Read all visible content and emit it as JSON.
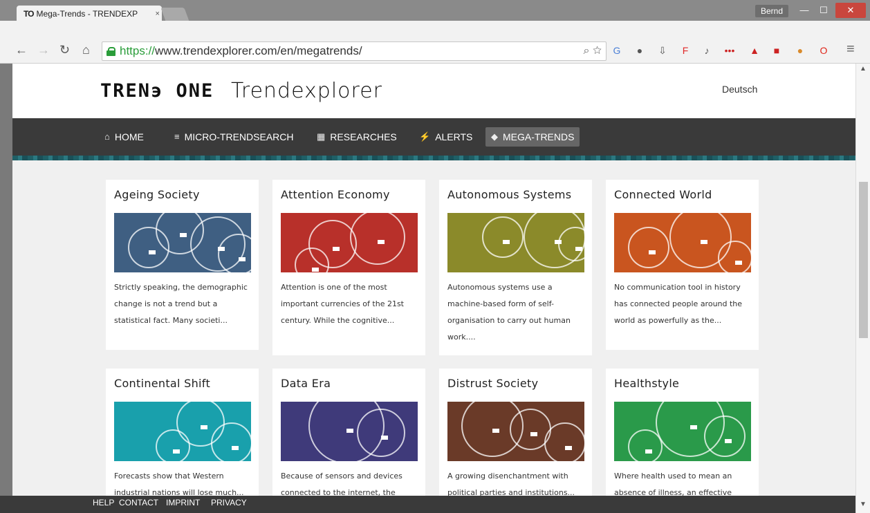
{
  "browser": {
    "tab_title": "Mega-Trends - TRENDEXP",
    "tab_favicon": "TO",
    "tab_close": "×",
    "user_name": "Bernd",
    "url_scheme": "https://",
    "url_rest": "www.trendexplorer.com/en/megatrends/",
    "icons": [
      "back-arrow-icon",
      "forward-arrow-icon",
      "reload-icon",
      "home-icon",
      "zoom-icon",
      "star-icon",
      "menu-icon"
    ],
    "extensions": [
      {
        "name": "translate-extension-icon",
        "color": "#4a7fd6"
      },
      {
        "name": "evernote-extension-icon",
        "color": "#555555"
      },
      {
        "name": "download-extension-icon",
        "color": "#555555"
      },
      {
        "name": "flipboard-extension-icon",
        "color": "#e12828"
      },
      {
        "name": "pushbullet-extension-icon",
        "color": "#555555"
      },
      {
        "name": "lastpass-extension-icon",
        "color": "#cc2222"
      },
      {
        "name": "ghostery-extension-icon",
        "color": "#cc2222"
      },
      {
        "name": "pixel-extension-icon",
        "color": "#cc2222"
      },
      {
        "name": "tampermonkey-extension-icon",
        "color": "#d98a2b"
      },
      {
        "name": "opera-extension-icon",
        "color": "#e0261a"
      }
    ]
  },
  "site": {
    "logo_mark": "TREN϶ ONE",
    "logo_text": "Trendexplorer",
    "lang": "Deutsch",
    "nav": [
      {
        "label": "HOME",
        "icon": "home-icon"
      },
      {
        "label": "MICRO-TRENDSEARCH",
        "icon": "layers-icon"
      },
      {
        "label": "RESEARCHES",
        "icon": "grid-icon"
      },
      {
        "label": "ALERTS",
        "icon": "bolt-icon"
      },
      {
        "label": "MEGA-TRENDS",
        "icon": "cube-icon"
      }
    ]
  },
  "cards": [
    {
      "title": "Ageing Society",
      "desc": "Strictly speaking, the demographic change is not a trend but a statistical fact. Many societi...",
      "color": "#3f5f82"
    },
    {
      "title": "Attention Economy",
      "desc": "Attention is one of the most important currencies of the 21st century. While the cognitive...",
      "color": "#b8302a"
    },
    {
      "title": "Autonomous Systems",
      "desc": "Autonomous systems use a machine-based form of self-organisation to carry out human work....",
      "color": "#8b8a2a"
    },
    {
      "title": "Connected World",
      "desc": "No communication tool in history has connected people around the world as powerfully as the...",
      "color": "#c9551f"
    },
    {
      "title": "Continental Shift",
      "desc": "Forecasts show that Western industrial nations will lose much...",
      "color": "#19a0ac"
    },
    {
      "title": "Data Era",
      "desc": "Because of sensors and devices connected to the internet, the volume...",
      "color": "#3f3a7a"
    },
    {
      "title": "Distrust Society",
      "desc": "A growing disenchantment with political parties and institutions...",
      "color": "#6a3a28"
    },
    {
      "title": "Healthstyle",
      "desc": "Where health used to mean an absence of illness, an effective life...",
      "color": "#2a9a4a"
    }
  ],
  "footer": {
    "help": "HELP",
    "contact": "CONTACT",
    "imprint": "IMPRINT",
    "privacy": "PRIVACY"
  }
}
